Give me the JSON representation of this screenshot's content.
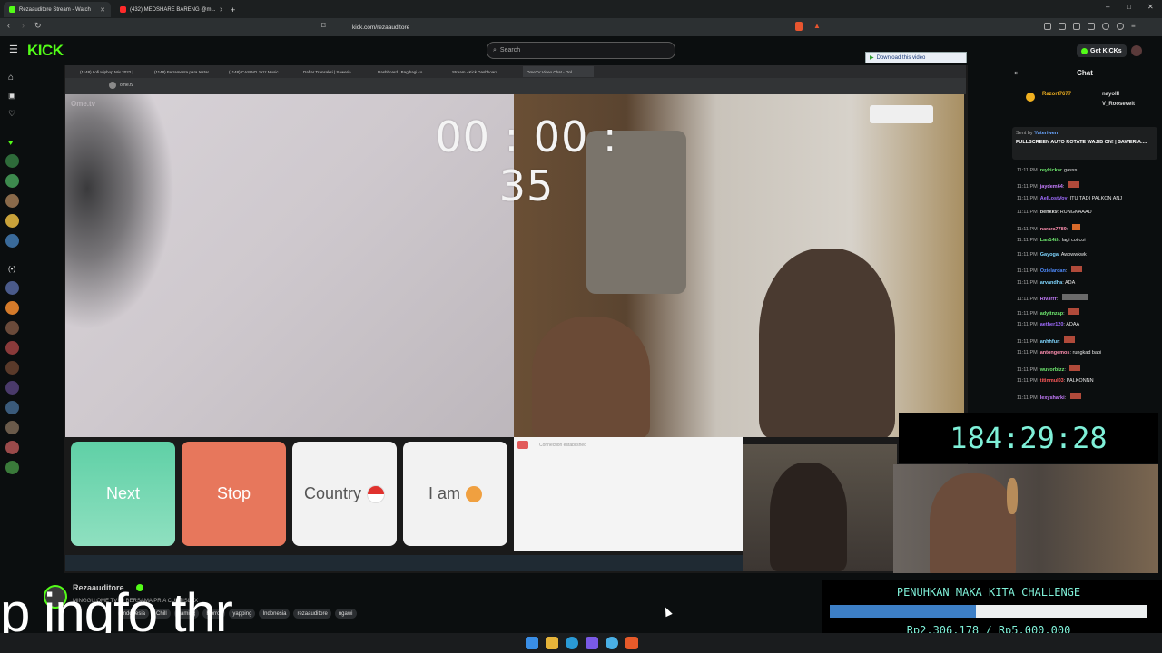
{
  "browser": {
    "tabs": [
      {
        "label": "Rezaauditore Stream - Watch",
        "color": "#53fc18"
      },
      {
        "label": "(432) MEDSHARE BARENG @m...",
        "color": "#ff2a2a"
      }
    ],
    "url": "kick.com/rezaauditore",
    "window_controls": [
      "–",
      "□",
      "✕"
    ]
  },
  "kick": {
    "logo": "KICK",
    "search_placeholder": "Search",
    "get_kicks": "Get KICKs",
    "download_video": "Download this video"
  },
  "inner_browser": {
    "tabs": [
      "(1148) Lofi Hiphop Mix 2022 |",
      "(1148) Ferramenta para testar",
      "(1148) CASINO Jazz Music",
      "Daftar Transaksi | Saweria",
      "Dashboard | Bagibagi.co",
      "Stream - Kick Dashboard",
      "OmeTV Video Chat - Onl..."
    ],
    "url": "ome.tv"
  },
  "ometv": {
    "logo": "Ome.tv",
    "timer": "00 : 00 : 35",
    "buttons": {
      "next": "Next",
      "stop": "Stop",
      "country": "Country",
      "i_am": "I am"
    },
    "connection_text": "Connection established"
  },
  "overlay": {
    "counter": "184:29:28",
    "challenge_title": "PENUHKAN MAKA KITA CHALLENGE",
    "challenge_amount": "Rp2.306.178 / Rp5.000.000",
    "challenge_progress": 0.461
  },
  "chat": {
    "title": "Chat",
    "top_users": [
      "Razort7677",
      "nayolll",
      "V_Roosevelt"
    ],
    "pinned_sender": "Sent by",
    "pinned_by": "Yuteriwen",
    "pinned_text": "FULLSCREEN AUTO ROTATE WAJIB ON! | SAWERIA:...",
    "messages": [
      {
        "time": "11:11 PM",
        "user": "reykickw",
        "text": "gasss",
        "color": "#6ee86e"
      },
      {
        "time": "11:11 PM",
        "user": "jaydem64",
        "text": "",
        "color": "#c77dff"
      },
      {
        "time": "11:11 PM",
        "user": "AelLostVoy",
        "text": "ITU TADI PALKON ANJ",
        "color": "#a06cff"
      },
      {
        "time": "11:11 PM",
        "user": "benkk9",
        "text": "RUNGKAAAD",
        "color": "#ddd"
      },
      {
        "time": "11:11 PM",
        "user": "narara7789",
        "text": "",
        "color": "#ff8fb0"
      },
      {
        "time": "11:11 PM",
        "user": "Lan14th",
        "text": "lagi coi coi",
        "color": "#6ee86e"
      },
      {
        "time": "11:11 PM",
        "user": "Gayoga",
        "text": "Awowwkwk",
        "color": "#7fd6ff"
      },
      {
        "time": "11:11 PM",
        "user": "Ozielardan",
        "text": "",
        "color": "#4f8cff"
      },
      {
        "time": "11:11 PM",
        "user": "arvandha",
        "text": "ADA",
        "color": "#7fd6ff"
      },
      {
        "time": "11:11 PM",
        "user": "Riv3rrr",
        "text": "",
        "color": "#c77dff"
      },
      {
        "time": "11:11 PM",
        "user": "adyitnzap",
        "text": "",
        "color": "#6ee86e"
      },
      {
        "time": "11:11 PM",
        "user": "aether120",
        "text": "ADAA",
        "color": "#a06cff"
      },
      {
        "time": "11:11 PM",
        "user": "anhhfur",
        "text": "",
        "color": "#7fd6ff"
      },
      {
        "time": "11:11 PM",
        "user": "antongemos",
        "text": "rungkad babi",
        "color": "#ff8fb0"
      },
      {
        "time": "11:11 PM",
        "user": "wuvorbizz",
        "text": "",
        "color": "#6ee86e"
      },
      {
        "time": "11:11 PM",
        "user": "titinmul03",
        "text": "PALKONNN",
        "color": "#ff5a5a"
      },
      {
        "time": "11:11 PM",
        "user": "lexysharki",
        "text": "",
        "color": "#c77dff"
      }
    ]
  },
  "stream_info": {
    "channel": "Rezaauditore",
    "title": "MINGGU OME TV DI BERSAMA PRIA CURTISLAX",
    "tags": [
      "Indonesia",
      "Chill",
      "gaming",
      "Horror",
      "yapping",
      "Indonesia",
      "rezaauditore",
      "ngawi"
    ],
    "caption": "p ingfo thr"
  }
}
